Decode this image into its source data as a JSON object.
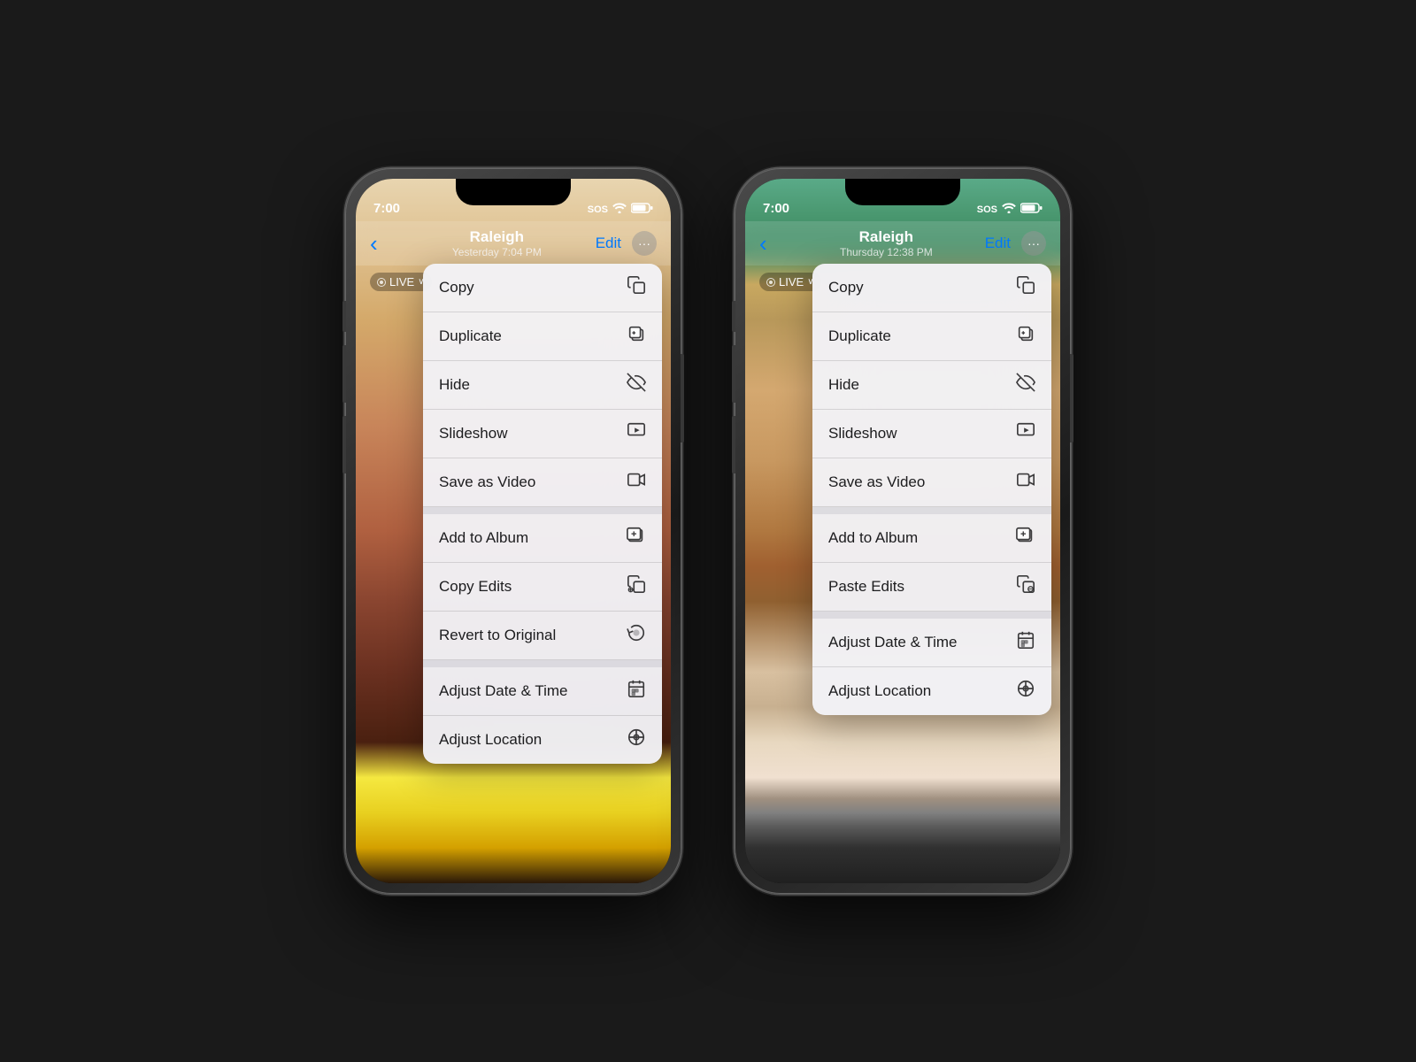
{
  "phones": [
    {
      "id": "left",
      "status": {
        "time": "7:00",
        "sos": "SOS",
        "wifi": "wifi",
        "battery": "battery"
      },
      "nav": {
        "back_label": "‹",
        "title": "Raleigh",
        "subtitle": "Yesterday  7:04 PM",
        "edit_label": "Edit",
        "more_label": "···"
      },
      "live_label": "⊙ LIVE ∨",
      "menu": [
        {
          "label": "Copy",
          "icon": "⎘",
          "section": 1
        },
        {
          "label": "Duplicate",
          "icon": "⧉",
          "section": 1
        },
        {
          "label": "Hide",
          "icon": "👁",
          "section": 1
        },
        {
          "label": "Slideshow",
          "icon": "▶",
          "section": 1
        },
        {
          "label": "Save as Video",
          "icon": "📹",
          "section": 1
        },
        {
          "label": "Add to Album",
          "icon": "📁",
          "section": 2
        },
        {
          "label": "Copy Edits",
          "icon": "⎘",
          "section": 2
        },
        {
          "label": "Revert to Original",
          "icon": "↺",
          "section": 2
        },
        {
          "label": "Adjust Date & Time",
          "icon": "📅",
          "section": 3
        },
        {
          "label": "Adjust Location",
          "icon": "ℹ",
          "section": 3
        }
      ]
    },
    {
      "id": "right",
      "status": {
        "time": "7:00",
        "sos": "SOS",
        "wifi": "wifi",
        "battery": "battery"
      },
      "nav": {
        "back_label": "‹",
        "title": "Raleigh",
        "subtitle": "Thursday  12:38 PM",
        "edit_label": "Edit",
        "more_label": "···"
      },
      "live_label": "⊙ LIVE ∨",
      "menu": [
        {
          "label": "Copy",
          "icon": "⎘",
          "section": 1
        },
        {
          "label": "Duplicate",
          "icon": "⧉",
          "section": 1
        },
        {
          "label": "Hide",
          "icon": "👁",
          "section": 1
        },
        {
          "label": "Slideshow",
          "icon": "▶",
          "section": 1
        },
        {
          "label": "Save as Video",
          "icon": "📹",
          "section": 1
        },
        {
          "label": "Add to Album",
          "icon": "📁",
          "section": 2
        },
        {
          "label": "Paste Edits",
          "icon": "⎘",
          "section": 2
        },
        {
          "label": "Adjust Date & Time",
          "icon": "📅",
          "section": 3
        },
        {
          "label": "Adjust Location",
          "icon": "ℹ",
          "section": 3
        }
      ]
    }
  ],
  "colors": {
    "accent": "#007aff",
    "menu_bg": "rgba(242,242,247,0.96)",
    "divider": "rgba(0,0,0,0.12)"
  }
}
